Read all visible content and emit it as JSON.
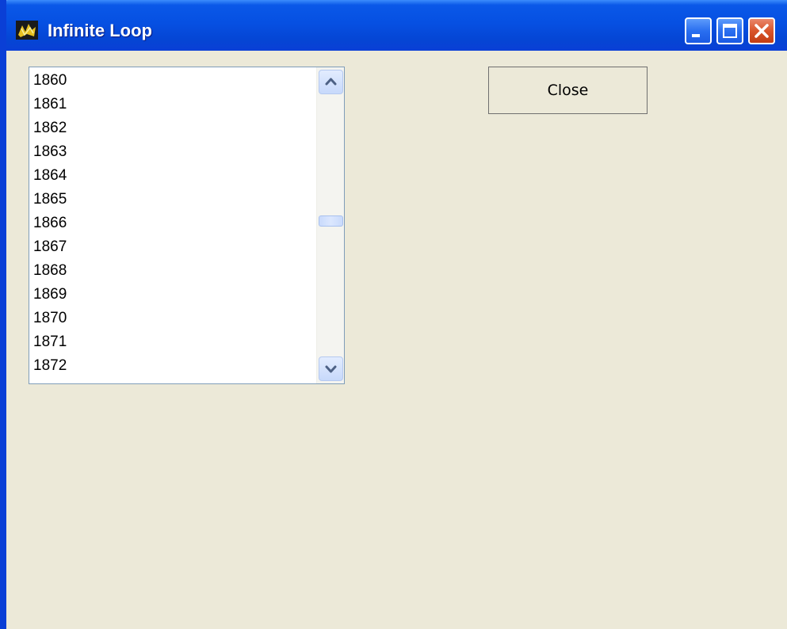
{
  "window": {
    "title": "Infinite Loop",
    "icon": "app-icon",
    "controls": {
      "minimize_icon": "minimize-icon",
      "maximize_icon": "maximize-icon",
      "close_icon": "close-icon"
    }
  },
  "list": {
    "items": [
      "1860",
      "1861",
      "1862",
      "1863",
      "1864",
      "1865",
      "1866",
      "1867",
      "1868",
      "1869",
      "1870",
      "1871",
      "1872"
    ],
    "scroll_up_icon": "chevron-up-icon",
    "scroll_down_icon": "chevron-down-icon"
  },
  "buttons": {
    "close_label": "Close"
  },
  "colors": {
    "titlebar": "#0650e2",
    "window_background": "#ece9d8",
    "window_close_button": "#d9542b"
  }
}
